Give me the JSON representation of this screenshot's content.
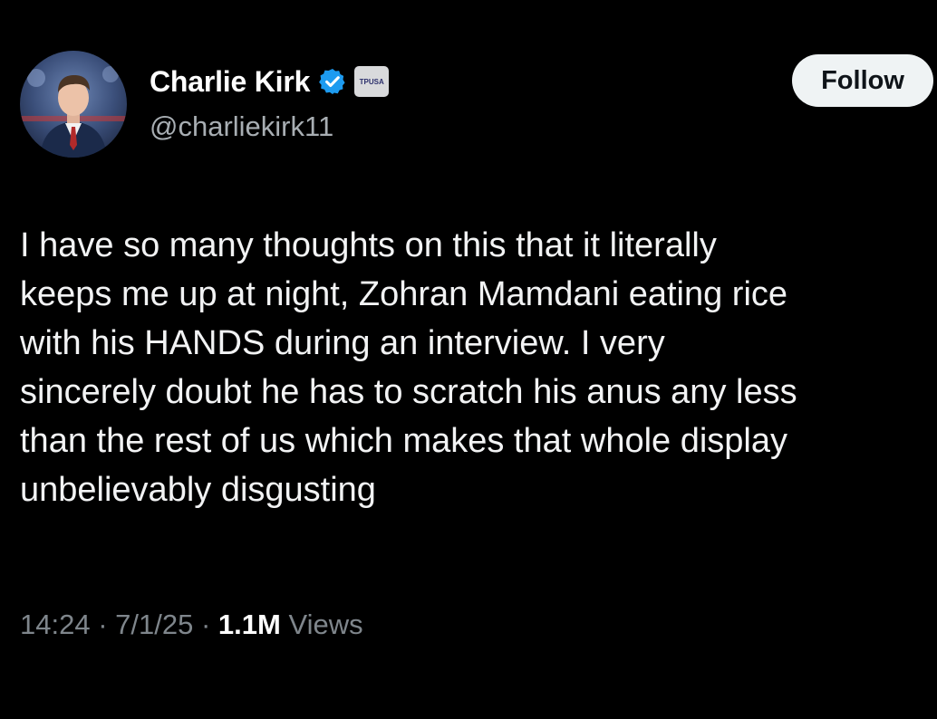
{
  "author": {
    "display_name": "Charlie Kirk",
    "handle": "@charliekirk11",
    "verified": true,
    "affiliation_badge_text": "TPUSA"
  },
  "follow_button": {
    "label": "Follow"
  },
  "post": {
    "lines": [
      "I have so many thoughts on this that it literally",
      "keeps me up at night, Zohran Mamdani eating rice",
      "with his HANDS during an interview. I very",
      "sincerely doubt he has to scratch his anus any less",
      "than the rest of us which makes that whole display",
      "unbelievably disgusting"
    ]
  },
  "meta": {
    "time": "14:24",
    "separator": "·",
    "date": "7/1/25",
    "views_count": "1.1M",
    "views_label": "Views"
  },
  "colors": {
    "background": "#000000",
    "verified_blue": "#1d9bf0",
    "follow_bg": "#eff3f4",
    "muted_text": "#7f868c"
  },
  "icons": {
    "verified": "verified-badge-icon",
    "affiliation": "affiliation-badge-icon"
  }
}
